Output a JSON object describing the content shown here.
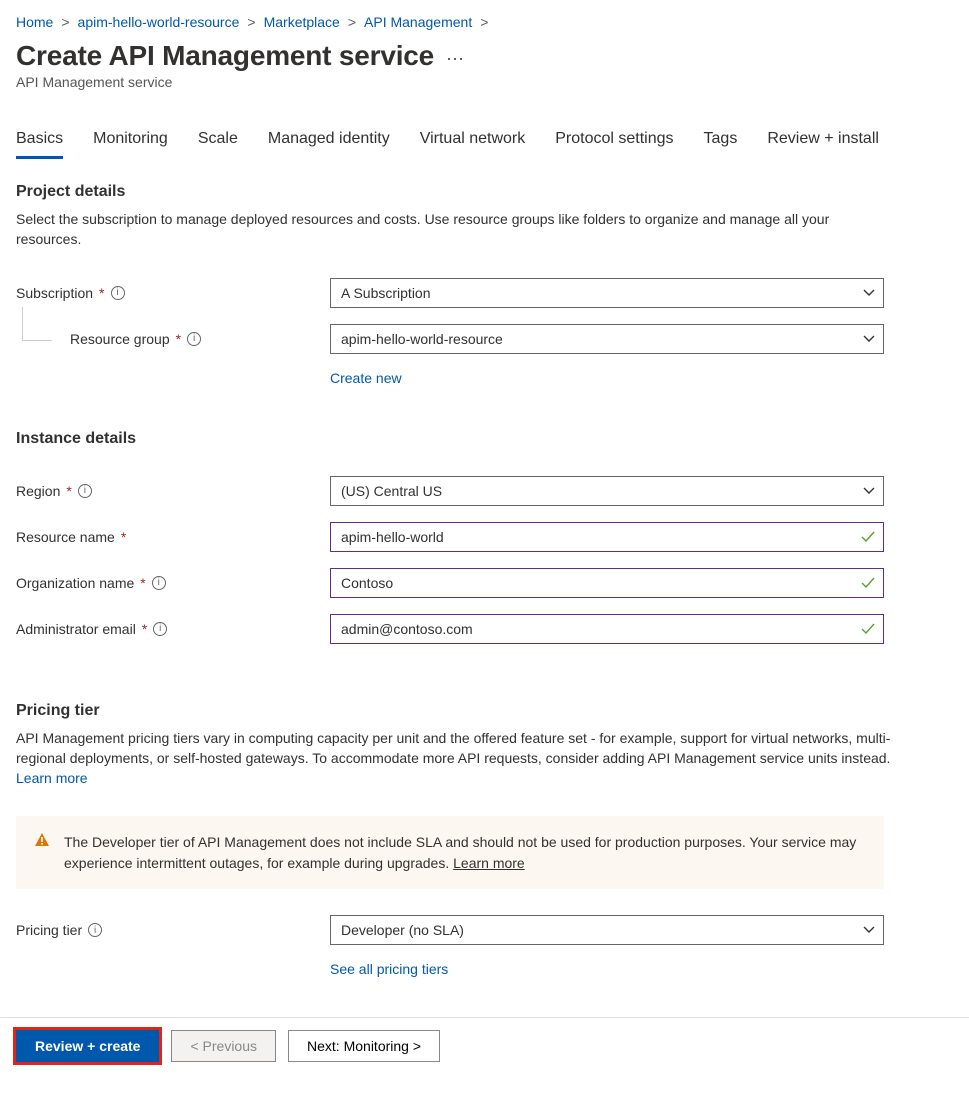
{
  "breadcrumbs": [
    {
      "label": "Home"
    },
    {
      "label": "apim-hello-world-resource"
    },
    {
      "label": "Marketplace"
    },
    {
      "label": "API Management"
    }
  ],
  "header": {
    "title": "Create API Management service",
    "subtitle": "API Management service"
  },
  "tabs": [
    {
      "label": "Basics",
      "active": true
    },
    {
      "label": "Monitoring"
    },
    {
      "label": "Scale"
    },
    {
      "label": "Managed identity"
    },
    {
      "label": "Virtual network"
    },
    {
      "label": "Protocol settings"
    },
    {
      "label": "Tags"
    },
    {
      "label": "Review + install"
    }
  ],
  "sections": {
    "project": {
      "heading": "Project details",
      "desc": "Select the subscription to manage deployed resources and costs. Use resource groups like folders to organize and manage all your resources."
    },
    "instance": {
      "heading": "Instance details"
    },
    "pricing": {
      "heading": "Pricing tier",
      "desc": "API Management pricing tiers vary in computing capacity per unit and the offered feature set - for example, support for virtual networks, multi-regional deployments, or self-hosted gateways. To accommodate more API requests, consider adding API Management service units instead.",
      "learn": "Learn more"
    }
  },
  "fields": {
    "subscription": {
      "label": "Subscription",
      "value": "A Subscription"
    },
    "resource_group": {
      "label": "Resource group",
      "value": "apim-hello-world-resource",
      "create_new": "Create new"
    },
    "region": {
      "label": "Region",
      "value": "(US) Central US"
    },
    "resource_name": {
      "label": "Resource name",
      "value": "apim-hello-world"
    },
    "org_name": {
      "label": "Organization name",
      "value": "Contoso"
    },
    "admin_email": {
      "label": "Administrator email",
      "value": "admin@contoso.com"
    },
    "pricing_tier": {
      "label": "Pricing tier",
      "value": "Developer (no SLA)",
      "see_all": "See all pricing tiers"
    }
  },
  "warning": {
    "text": "The Developer tier of API Management does not include SLA and should not be used for production purposes. Your service may experience intermittent outages, for example during upgrades.",
    "learn": "Learn more"
  },
  "footer": {
    "review": "Review + create",
    "previous": "< Previous",
    "next": "Next: Monitoring >"
  }
}
